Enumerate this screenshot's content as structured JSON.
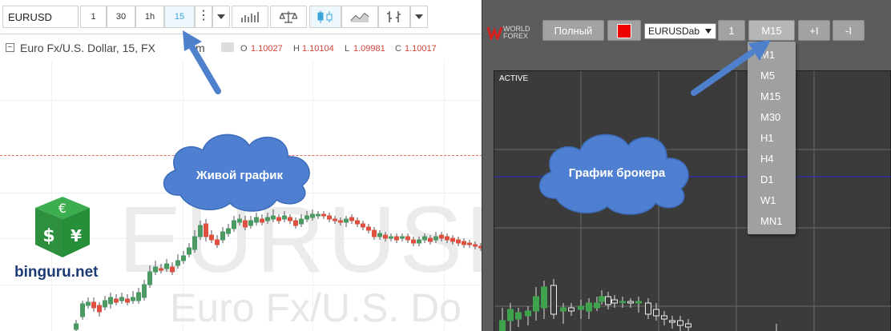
{
  "left": {
    "symbol": "EURUSD",
    "intervals": [
      "1",
      "30",
      "1h",
      "15"
    ],
    "active_interval": "15",
    "header_title": "Euro Fx/U.S. Dollar, 15, FX",
    "header_trailing": "m",
    "ohlc": {
      "o_label": "O",
      "o_value": "1.10027",
      "h_label": "H",
      "h_value": "1.10104",
      "l_label": "L",
      "l_value": "1.09981",
      "c_label": "C",
      "c_value": "1.10017"
    },
    "watermark_symbol": "EURUSD,",
    "watermark_desc": "Euro Fx/U.S. Do",
    "cloud_label": "Живой график",
    "logo_text": "binguru.net"
  },
  "right": {
    "logo_line1": "WORLD",
    "logo_line2": "FOREX",
    "full_button": "Полный",
    "symbol_select": "EURUSDab",
    "btn_1": "1",
    "btn_timeframe": "M15",
    "btn_plus": "+I",
    "btn_minus": "-I",
    "chart_label": "ACTIVE",
    "cloud_label": "График брокера",
    "timeframes": [
      "M1",
      "M5",
      "M15",
      "M30",
      "H1",
      "H4",
      "D1",
      "W1",
      "MN1"
    ]
  },
  "colors": {
    "bull": "#4b9a63",
    "bear": "#e05040",
    "cloud": "#4e7fd0",
    "arrow": "#4f80cc",
    "active_interval": "#3ba5d8",
    "broker_line": "#2b2bd0"
  }
}
